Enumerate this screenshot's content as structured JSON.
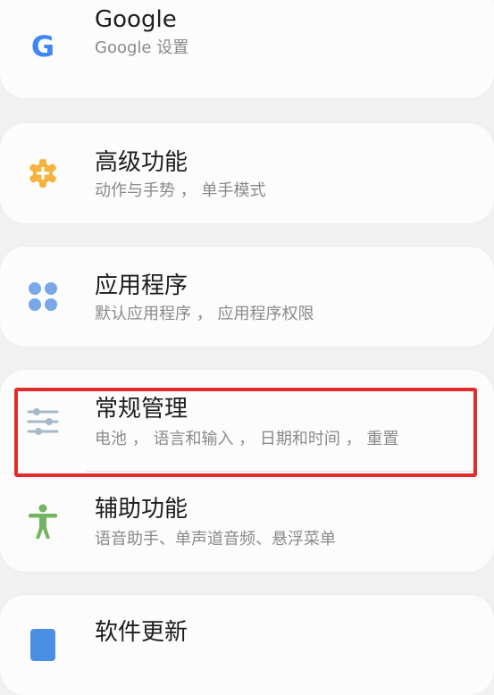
{
  "settings": {
    "items": [
      {
        "title": "Google",
        "subtitle": "Google 设置",
        "icon": "google-icon"
      },
      {
        "title": "高级功能",
        "subtitle": "动作与手势 ， 单手模式",
        "icon": "gear-plus-icon"
      },
      {
        "title": "应用程序",
        "subtitle": "默认应用程序 ， 应用程序权限",
        "icon": "apps-icon"
      },
      {
        "title": "常规管理",
        "subtitle": "电池 ， 语言和输入 ， 日期和时间 ， 重置",
        "icon": "sliders-icon"
      },
      {
        "title": "辅助功能",
        "subtitle": "语音助手、单声道音频、悬浮菜单",
        "icon": "accessibility-icon"
      },
      {
        "title": "软件更新",
        "subtitle": "",
        "icon": "software-update-icon"
      }
    ]
  },
  "colors": {
    "google_blue": "#4285f4",
    "advanced_orange": "#f7b23b",
    "apps_blue": "#78a8e8",
    "general_gray": "#a6b8c9",
    "accessibility_green": "#72b45f",
    "update_blue": "#4a90e2",
    "highlight_red": "#e32b2b"
  }
}
